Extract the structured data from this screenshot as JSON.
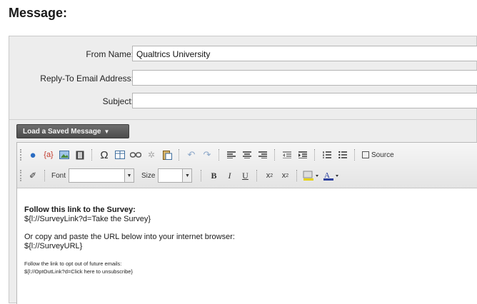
{
  "header": {
    "title": "Message:"
  },
  "form": {
    "from_name": {
      "label": "From Name:",
      "value": "Qualtrics University"
    },
    "reply_to": {
      "label": "Reply-To Email Address:",
      "value": ""
    },
    "subject": {
      "label": "Subject:",
      "value": ""
    }
  },
  "load_button": {
    "label": "Load a Saved Message"
  },
  "toolbar": {
    "source_label": "Source",
    "font_label": "Font",
    "size_label": "Size",
    "font_value": "",
    "size_value": ""
  },
  "body": {
    "line1": "Follow this link to the Survey:",
    "line2": "${l://SurveyLink?d=Take the Survey}",
    "line3": "Or copy and paste the URL below into your internet browser:",
    "line4": "${l://SurveyURL}",
    "line5": "Follow the link to opt out of future emails:",
    "line6": "${l://OptOutLink?d=Click here to unsubscribe}"
  },
  "colors": {
    "panel_bg": "#ededed",
    "button_bg": "#555555",
    "link_icon": "#2a6cc2",
    "highlight": "#e6d200"
  }
}
